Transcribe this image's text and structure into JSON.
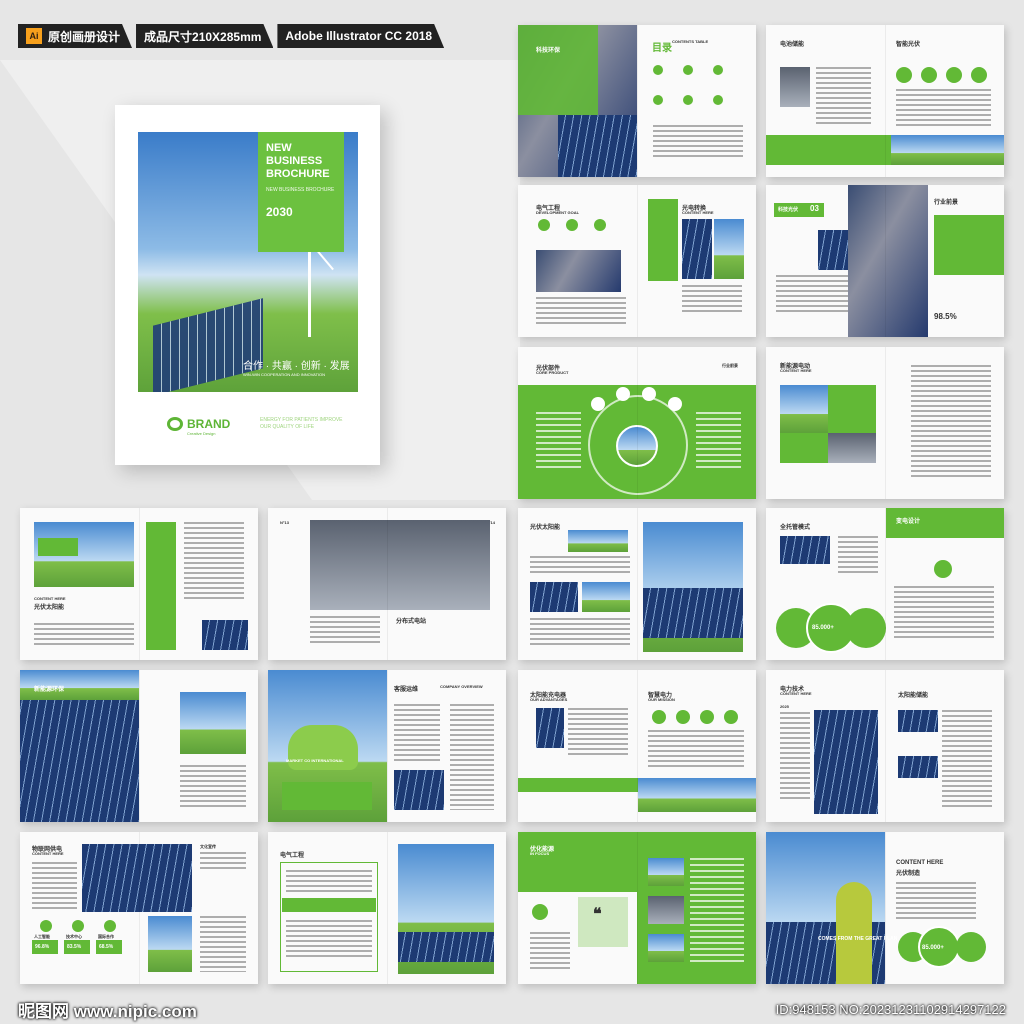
{
  "topbar": {
    "ai_icon": "Ai",
    "tag1": "原创画册设计",
    "tag2": "成品尺寸210X285mm",
    "tag3": "Adobe Illustrator CC 2018"
  },
  "cover": {
    "title": "NEW BUSINESS BROCHURE",
    "subtitle": "NEW BUSINESS BROCHURE",
    "year": "2030",
    "slogan": "合作 · 共赢 · 创新 · 发展",
    "slogan_en": "WIN-WIN COOPERATION AND INNOVATION",
    "brand": "BRAND",
    "brand_sub": "Creative Design",
    "note": "ENERGY FOR PATIENTS IMPROVE OUR QUALITY OF LIFE"
  },
  "spreads": [
    {
      "title": "科技环保",
      "title2": "目录",
      "title2_en": "CONTENTS TABLE"
    },
    {
      "title": "电池储能",
      "title2": "智能光伏"
    },
    {
      "title": "电气工程",
      "title_en": "DEVELOPMENT GOAL",
      "title2": "光电转换",
      "title2_en": "CONTENT HERE"
    },
    {
      "title": "科技光伏",
      "num": "03",
      "title2": "行业前景",
      "stat": "98.5%"
    },
    {
      "title": "光伏部件",
      "title_en": "CORE PRODUCT",
      "title2": "行业前景"
    },
    {
      "title": "新能源电动",
      "title_en": "CONTENT HERE"
    },
    {
      "title": "光伏太阳能",
      "title_en": "CONTENT HERE",
      "sub": "COMPANY PROFILE"
    },
    {
      "title": "分布式电站",
      "num": "N°13",
      "num2": "N°14"
    },
    {
      "title": "光伏太阳能"
    },
    {
      "title": "全托管模式",
      "title2": "变电设计",
      "stat": "85.000+"
    },
    {
      "title": "新能源环保"
    },
    {
      "title": "客服运维",
      "title_en": "COMPANY OVERVIEW",
      "sub": "MARKET CO INTERNATIONAL"
    },
    {
      "title": "太阳能充电器",
      "title_en": "OUR ADVANTAGES",
      "title2": "智慧电力",
      "title2_en": "OUR MISSION"
    },
    {
      "title": "电力技术",
      "title_en": "CONTENT HERE",
      "title2": "太阳能储能",
      "year": "2025"
    },
    {
      "title": "物联网供电",
      "title_en": "CONTENT HERE",
      "title2": "文化宣传",
      "stats": [
        "96.8%",
        "83.5%",
        "68.5%"
      ],
      "labels": [
        "人工智能",
        "技术中心",
        "国际合作"
      ]
    },
    {
      "title": "电气工程"
    },
    {
      "title": "优化能源",
      "title_en": "IN FOCUS"
    },
    {
      "title": "CONTENT HERE",
      "title2": "光伏制造",
      "stat": "85.000+",
      "sub": "COMES FROM THE GREAT PLAN"
    }
  ],
  "watermark": {
    "left": "昵图网 www.nipic.com",
    "right": "ID:948153 NO:20231231102914297122"
  }
}
